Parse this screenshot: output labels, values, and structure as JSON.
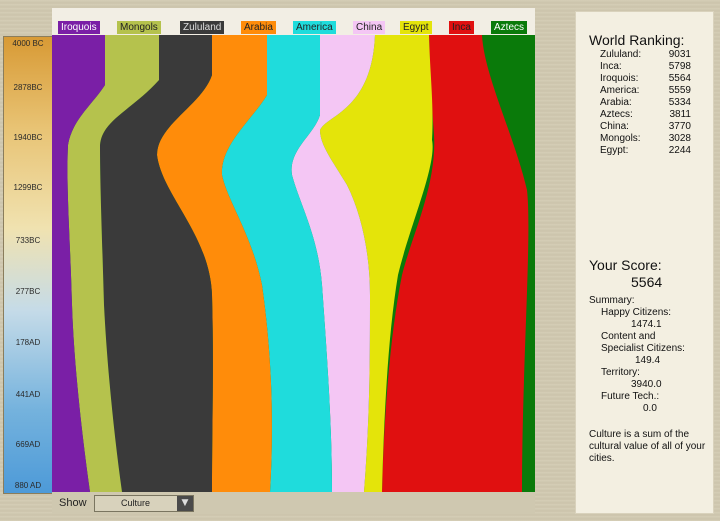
{
  "civilizations": [
    {
      "name": "Iroquois",
      "color": "#7a1fa6",
      "labelColor": "#ffffff"
    },
    {
      "name": "Mongols",
      "color": "#b5c24d",
      "labelColor": "#222222"
    },
    {
      "name": "Zululand",
      "color": "#3a3a3a",
      "labelColor": "#dddddd"
    },
    {
      "name": "Arabia",
      "color": "#ff8c0a",
      "labelColor": "#222222"
    },
    {
      "name": "America",
      "color": "#1fdcdc",
      "labelColor": "#222222"
    },
    {
      "name": "China",
      "color": "#f4c6f4",
      "labelColor": "#222222"
    },
    {
      "name": "Egypt",
      "color": "#e4e40a",
      "labelColor": "#222222"
    },
    {
      "name": "Inca",
      "color": "#e01010",
      "labelColor": "#222222"
    },
    {
      "name": "Aztecs",
      "color": "#0a7a0a",
      "labelColor": "#ffffff"
    }
  ],
  "timeline": [
    "4000 BC",
    "2878BC",
    "1940BC",
    "1299BC",
    "733BC",
    "277BC",
    "178AD",
    "441AD",
    "669AD",
    "880 AD"
  ],
  "show": {
    "label": "Show",
    "selected": "Culture"
  },
  "ranking": {
    "title": "World Ranking:",
    "entries": [
      {
        "civ": "Zululand:",
        "score": "9031"
      },
      {
        "civ": "Inca:",
        "score": "5798"
      },
      {
        "civ": "Iroquois:",
        "score": "5564"
      },
      {
        "civ": "America:",
        "score": "5559"
      },
      {
        "civ": "Arabia:",
        "score": "5334"
      },
      {
        "civ": "Aztecs:",
        "score": "3811"
      },
      {
        "civ": "China:",
        "score": "3770"
      },
      {
        "civ": "Mongols:",
        "score": "3028"
      },
      {
        "civ": "Egypt:",
        "score": "2244"
      }
    ]
  },
  "score": {
    "title": "Your Score:",
    "value": "5564",
    "summary": "Summary:",
    "happy_label": "Happy Citizens:",
    "happy_value": "1474.1",
    "content_label_1": "Content and",
    "content_label_2": "Specialist Citizens:",
    "content_value": "149.4",
    "territory_label": "Territory:",
    "territory_value": "3940.0",
    "future_label": "Future Tech.:",
    "future_value": "0.0"
  },
  "note": "Culture is a sum of the cultural value of all of your cities."
}
